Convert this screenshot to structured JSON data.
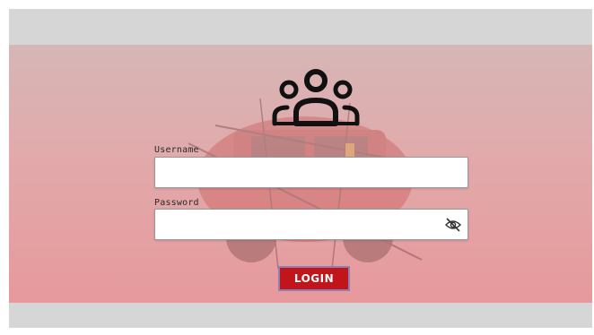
{
  "login": {
    "logo_icon": "users-group-icon",
    "username": {
      "label": "Username",
      "value": "",
      "placeholder": ""
    },
    "password": {
      "label": "Password",
      "value": "",
      "placeholder": "",
      "visibility_icon": "eye-off-icon"
    },
    "submit_label": "LOGIN"
  },
  "colors": {
    "login_button": "#c0151b",
    "background_tint": "#e6999c",
    "frame": "#d6d6d6"
  }
}
